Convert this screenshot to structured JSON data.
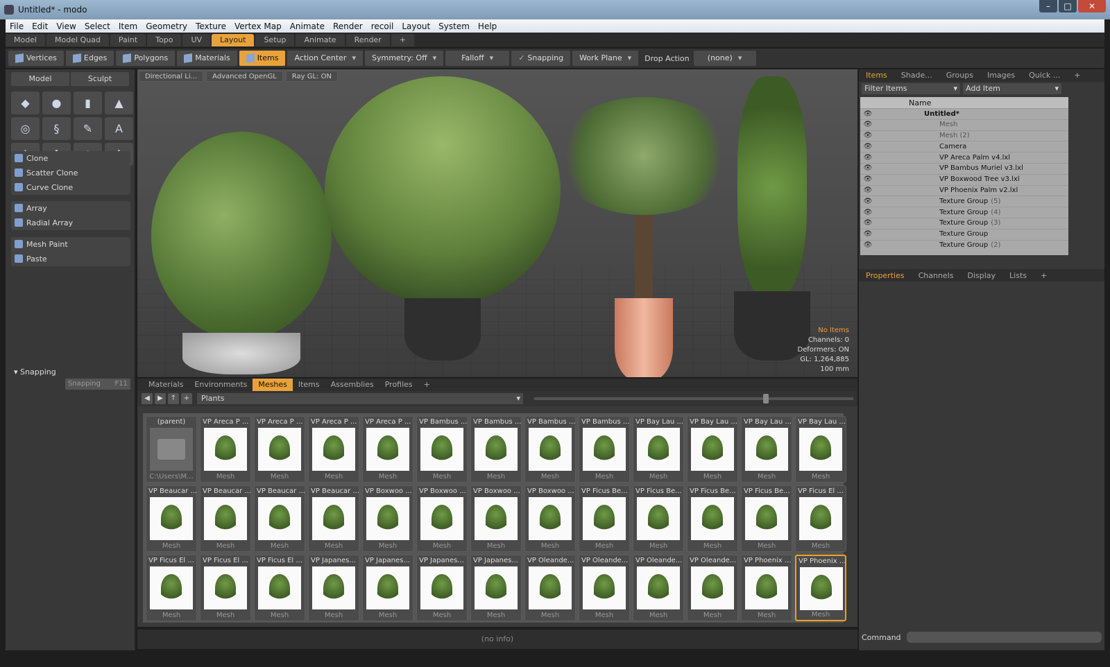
{
  "window": {
    "title": "Untitled* - modo"
  },
  "menu": [
    "File",
    "Edit",
    "View",
    "Select",
    "Item",
    "Geometry",
    "Texture",
    "Vertex Map",
    "Animate",
    "Render",
    "recoil",
    "Layout",
    "System",
    "Help"
  ],
  "layout_tabs": [
    "Model",
    "Model Quad",
    "Paint",
    "Topo",
    "UV",
    "Layout",
    "Setup",
    "Animate",
    "Render",
    "+"
  ],
  "active_layout_tab": "Layout",
  "toolbar": {
    "vertices": "Vertices",
    "edges": "Edges",
    "polygons": "Polygons",
    "materials": "Materials",
    "items": "Items",
    "action_center": "Action Center",
    "symmetry": "Symmetry: Off",
    "falloff": "Falloff",
    "snapping": "Snapping",
    "work_plane": "Work Plane",
    "drop_action_label": "Drop Action",
    "drop_action_value": "(none)"
  },
  "left": {
    "mode_model": "Model",
    "mode_sculpt": "Sculpt",
    "tool_icons": [
      "◆",
      "●",
      "▮",
      "▲",
      "◎",
      "§",
      "✎",
      "A",
      "✛",
      "✚",
      "◉",
      "✥"
    ],
    "group1": [
      "Clone",
      "Scatter Clone",
      "Curve Clone"
    ],
    "group2": [
      "Array",
      "Radial Array"
    ],
    "group3": [
      "Mesh Paint",
      "Paste"
    ],
    "snapping_header": "Snapping",
    "snapping_button": "Snapping",
    "snapping_key": "F11"
  },
  "viewport": {
    "buttons": [
      "Directional Li...",
      "Advanced OpenGL",
      "Ray GL: ON"
    ],
    "hud": {
      "items": "No Items",
      "channels": "Channels: 0",
      "deformers": "Deformers: ON",
      "gl": "GL: 1,264,885",
      "size": "100 mm"
    }
  },
  "presets": {
    "tabs": [
      "Materials",
      "Environments",
      "Meshes",
      "Items",
      "Assemblies",
      "Profiles",
      "+"
    ],
    "active_tab": "Meshes",
    "path": "Plants",
    "parent": {
      "label": "(parent)",
      "path": "C:\\Users\\M..."
    },
    "cells": [
      "VP Areca P ...",
      "VP Areca P ...",
      "VP Areca P ...",
      "VP Areca P ...",
      "VP Bambus ...",
      "VP Bambus ...",
      "VP Bambus ...",
      "VP Bambus ...",
      "VP Bay Lau ...",
      "VP Bay Lau ...",
      "VP Bay Lau ...",
      "VP Bay Lau ...",
      "VP Beaucar ...",
      "VP Beaucar ...",
      "VP Beaucar ...",
      "VP Beaucar ...",
      "VP Boxwoo ...",
      "VP Boxwoo ...",
      "VP Boxwoo ...",
      "VP Boxwoo ...",
      "VP Ficus Be...",
      "VP Ficus Be...",
      "VP Ficus Be...",
      "VP Ficus Be...",
      "VP Ficus El ...",
      "VP Ficus El ...",
      "VP Ficus El ...",
      "VP Ficus El ...",
      "VP Japanes...",
      "VP Japanes...",
      "VP Japanes...",
      "VP Japanes...",
      "VP Oleande...",
      "VP Oleande...",
      "VP Oleande...",
      "VP Oleande...",
      "VP Phoenix ...",
      "VP Phoenix ..."
    ],
    "cell_type": "Mesh",
    "status": "(no info)"
  },
  "right": {
    "tabs": [
      "Items",
      "Shade...",
      "Groups",
      "Images",
      "Quick ...",
      "+"
    ],
    "active_tab": "Items",
    "filter": "Filter Items",
    "add_item": "Add Item",
    "tree_header": "Name",
    "tree": [
      {
        "label": "Untitled*",
        "dim": false
      },
      {
        "label": "Mesh",
        "dim": true
      },
      {
        "label": "Mesh (2)",
        "dim": true
      },
      {
        "label": "Camera",
        "dim": false
      },
      {
        "label": "VP Areca Palm v4.lxl",
        "dim": false
      },
      {
        "label": "VP Bambus Muriel v3.lxl",
        "dim": false
      },
      {
        "label": "VP Boxwood Tree v3.lxl",
        "dim": false
      },
      {
        "label": "VP Phoenix Palm v2.lxl",
        "dim": false
      },
      {
        "label": "Texture Group",
        "suffix": "(5)",
        "dim": false
      },
      {
        "label": "Texture Group",
        "suffix": "(4)",
        "dim": false
      },
      {
        "label": "Texture Group",
        "suffix": "(3)",
        "dim": false
      },
      {
        "label": "Texture Group",
        "suffix": "",
        "dim": false
      },
      {
        "label": "Texture Group",
        "suffix": "(2)",
        "dim": false
      }
    ],
    "prop_tabs": [
      "Properties",
      "Channels",
      "Display",
      "Lists",
      "+"
    ],
    "active_prop_tab": "Properties",
    "command_label": "Command"
  },
  "colors": {
    "accent": "#e9a23b",
    "selection": "#f0a020"
  }
}
